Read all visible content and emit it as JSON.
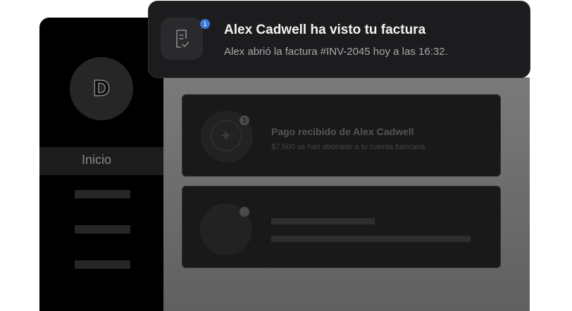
{
  "sidebar": {
    "avatar_letter": "D",
    "active_item": "Inicio"
  },
  "notification": {
    "badge_count": "1",
    "title": "Alex Cadwell ha visto tu factura",
    "message": "Alex abrió la factura #INV-2045 hoy a las 16:32.",
    "icon": "invoice-check-icon"
  },
  "cards": [
    {
      "badge_count": "1",
      "title": "Pago recibido de Alex Cadwell",
      "subtitle": "$7,500 se han abonado a tu cuenta bancaria",
      "icon": "payment-coin-icon"
    }
  ],
  "colors": {
    "accent": "#3a7bd5",
    "toast_bg": "#1c1c1e",
    "sidebar_bg": "#000000"
  }
}
